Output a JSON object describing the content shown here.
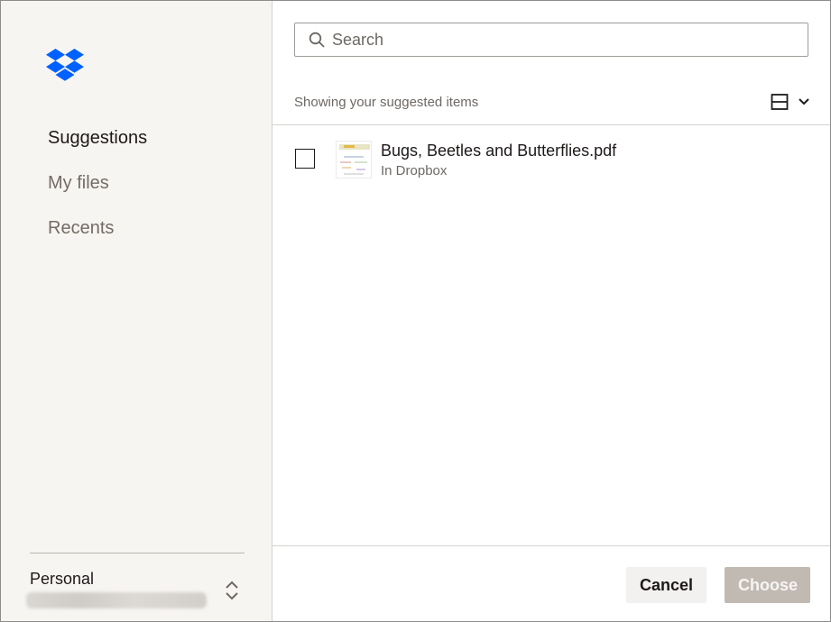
{
  "brand": {
    "logo_icon": "dropbox-logo-icon",
    "color": "#0061fe"
  },
  "sidebar": {
    "nav": [
      {
        "label": "Suggestions",
        "active": true
      },
      {
        "label": "My files",
        "active": false
      },
      {
        "label": "Recents",
        "active": false
      }
    ],
    "account": {
      "label": "Personal",
      "switch_icon": "chevron-up-down-icon"
    }
  },
  "main": {
    "search": {
      "placeholder": "Search",
      "value": "",
      "icon": "search-icon"
    },
    "section_heading": "Showing your suggested items",
    "view_toggle_icon": "layout-view-icon",
    "files": [
      {
        "name": "Bugs, Beetles and Butterflies.pdf",
        "location": "In Dropbox",
        "checked": false
      }
    ]
  },
  "footer": {
    "cancel_label": "Cancel",
    "choose_label": "Choose"
  }
}
